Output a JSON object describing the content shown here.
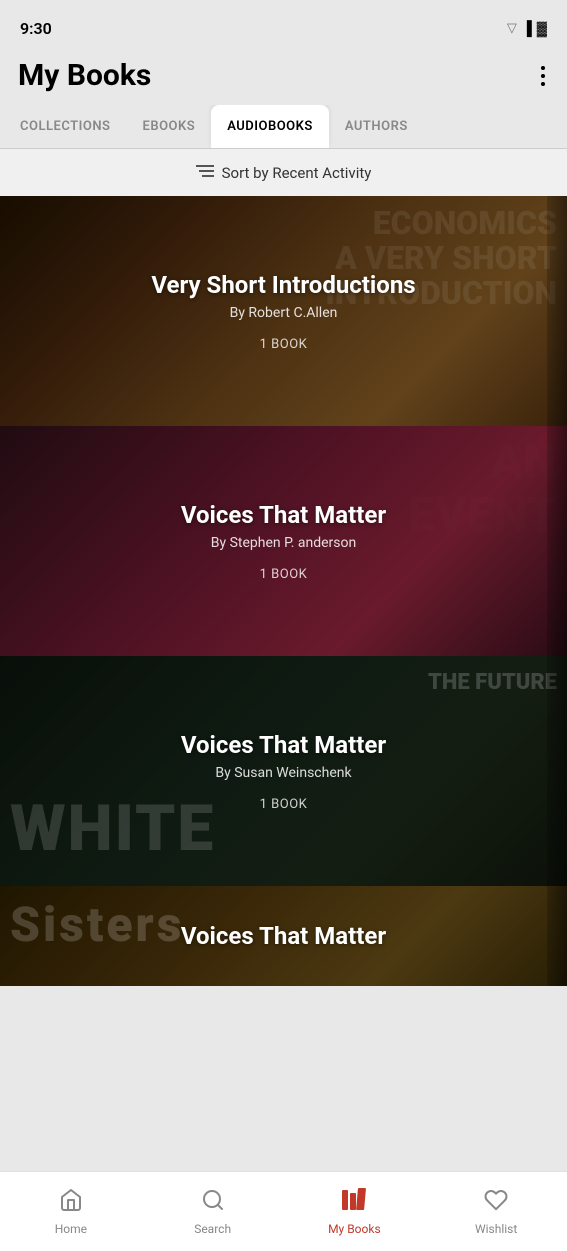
{
  "app": {
    "title": "My Books"
  },
  "statusBar": {
    "time": "9:30"
  },
  "header": {
    "title": "My Books",
    "menuLabel": "More options"
  },
  "tabs": [
    {
      "id": "collections",
      "label": "COLLECTIONS",
      "active": false
    },
    {
      "id": "ebooks",
      "label": "EBOOKS",
      "active": false
    },
    {
      "id": "audiobooks",
      "label": "AUDIOBOOKS",
      "active": true
    },
    {
      "id": "authors",
      "label": "AUTHORS",
      "active": false
    }
  ],
  "sortBar": {
    "label": "Sort by Recent Activity"
  },
  "books": [
    {
      "id": 1,
      "title": "Very Short Introductions",
      "author": "By Robert C.Allen",
      "count": "1 BOOK",
      "bgClass": "econ-bg",
      "decoText": "ECONOMICS\nA Very Short\nIntroduction"
    },
    {
      "id": 2,
      "title": "Voices That Matter",
      "author": "By Stephen P. anderson",
      "count": "1 BOOK",
      "bgClass": "voice-bg-1",
      "decoText": "AN EVENT"
    },
    {
      "id": 3,
      "title": "Voices That Matter",
      "author": "By Susan Weinschenk",
      "count": "1 BOOK",
      "bgClass": "voice-bg-2",
      "decoText": "THE FUTURE\nWHITE"
    },
    {
      "id": 4,
      "title": "Voices That Matter",
      "author": "",
      "count": "",
      "bgClass": "voice-bg-3",
      "decoText": "SISTERS"
    }
  ],
  "bottomNav": {
    "items": [
      {
        "id": "home",
        "label": "Home",
        "icon": "home",
        "active": false
      },
      {
        "id": "search",
        "label": "Search",
        "icon": "search",
        "active": false
      },
      {
        "id": "mybooks",
        "label": "My Books",
        "icon": "mybooks",
        "active": true
      },
      {
        "id": "wishlist",
        "label": "Wishlist",
        "icon": "heart",
        "active": false
      }
    ]
  }
}
